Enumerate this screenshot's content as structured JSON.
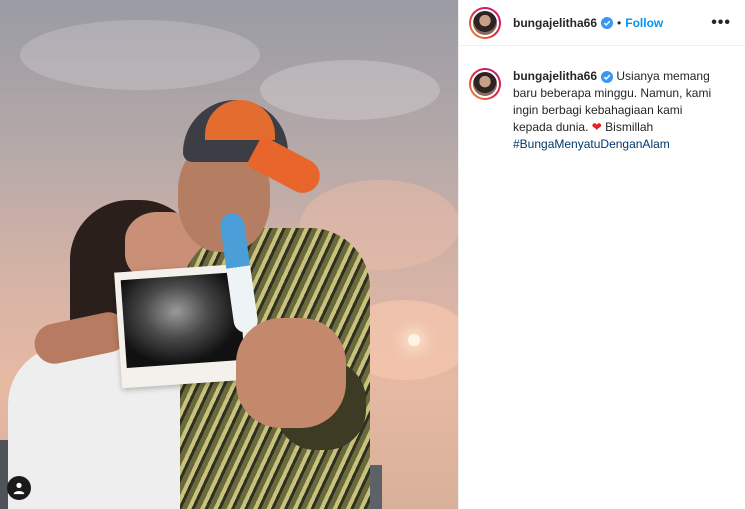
{
  "post": {
    "username": "bungajelitha66",
    "separator": "•",
    "follow_label": "Follow",
    "more_label": "•••",
    "caption_parts": {
      "line1": "Usianya memang baru beberapa minggu. Namun, kami ingin berbagi kebahagiaan kami kepada dunia.",
      "heart_emoji": "❤",
      "line2": "Bismillah",
      "hashtag": "#BungaMenyatuDenganAlam"
    }
  },
  "icons": {
    "verified": "verified-badge-icon",
    "heart": "heart-icon",
    "tagged_user": "user-tag-icon",
    "more": "more-options-icon"
  },
  "colors": {
    "link_blue": "#0095f6",
    "hashtag_blue": "#00376b",
    "heart_red": "#ed1c24",
    "verified_blue": "#3897f0"
  }
}
